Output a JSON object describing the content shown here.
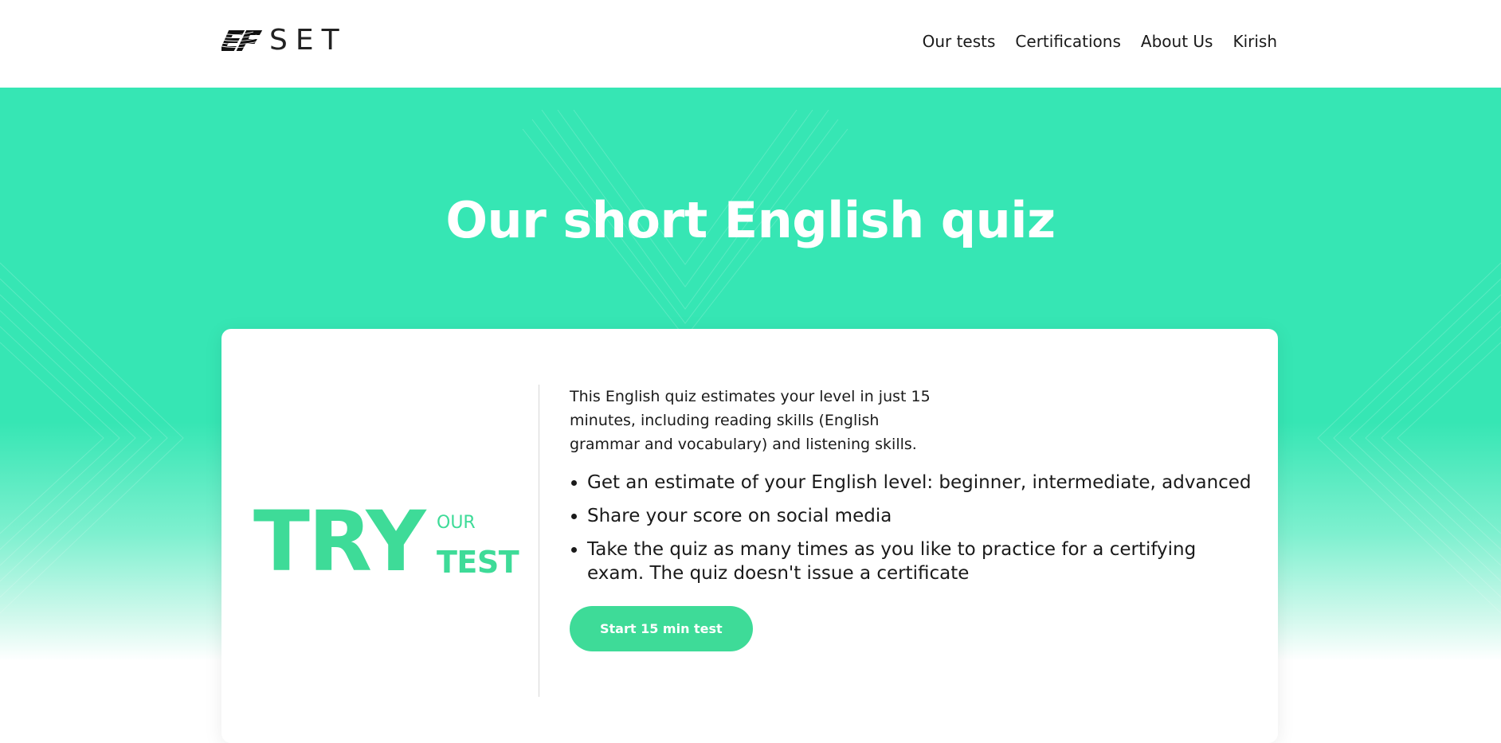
{
  "header": {
    "logo_text": "SET",
    "logo_mark": "EF",
    "nav": [
      {
        "label": "Our tests"
      },
      {
        "label": "Certifications"
      },
      {
        "label": "About Us"
      },
      {
        "label": "Kirish"
      }
    ]
  },
  "hero": {
    "title": "Our short English quiz"
  },
  "card": {
    "try_word": "TRY",
    "our_word": "OUR",
    "test_word": "TEST",
    "intro": "This English quiz estimates your level in just 15 minutes, including reading skills (English grammar and vocabulary) and listening skills.",
    "features": [
      "Get an estimate of your English level: beginner, intermediate, advanced",
      "Share your score on social media",
      "Take the quiz as many times as you like to practice for a certifying exam. The quiz doesn't issue a certificate"
    ],
    "start_button": "Start 15 min test"
  },
  "colors": {
    "hero_bg": "#36e6b4",
    "accent": "#3edb98",
    "text": "#1a1a1a"
  }
}
